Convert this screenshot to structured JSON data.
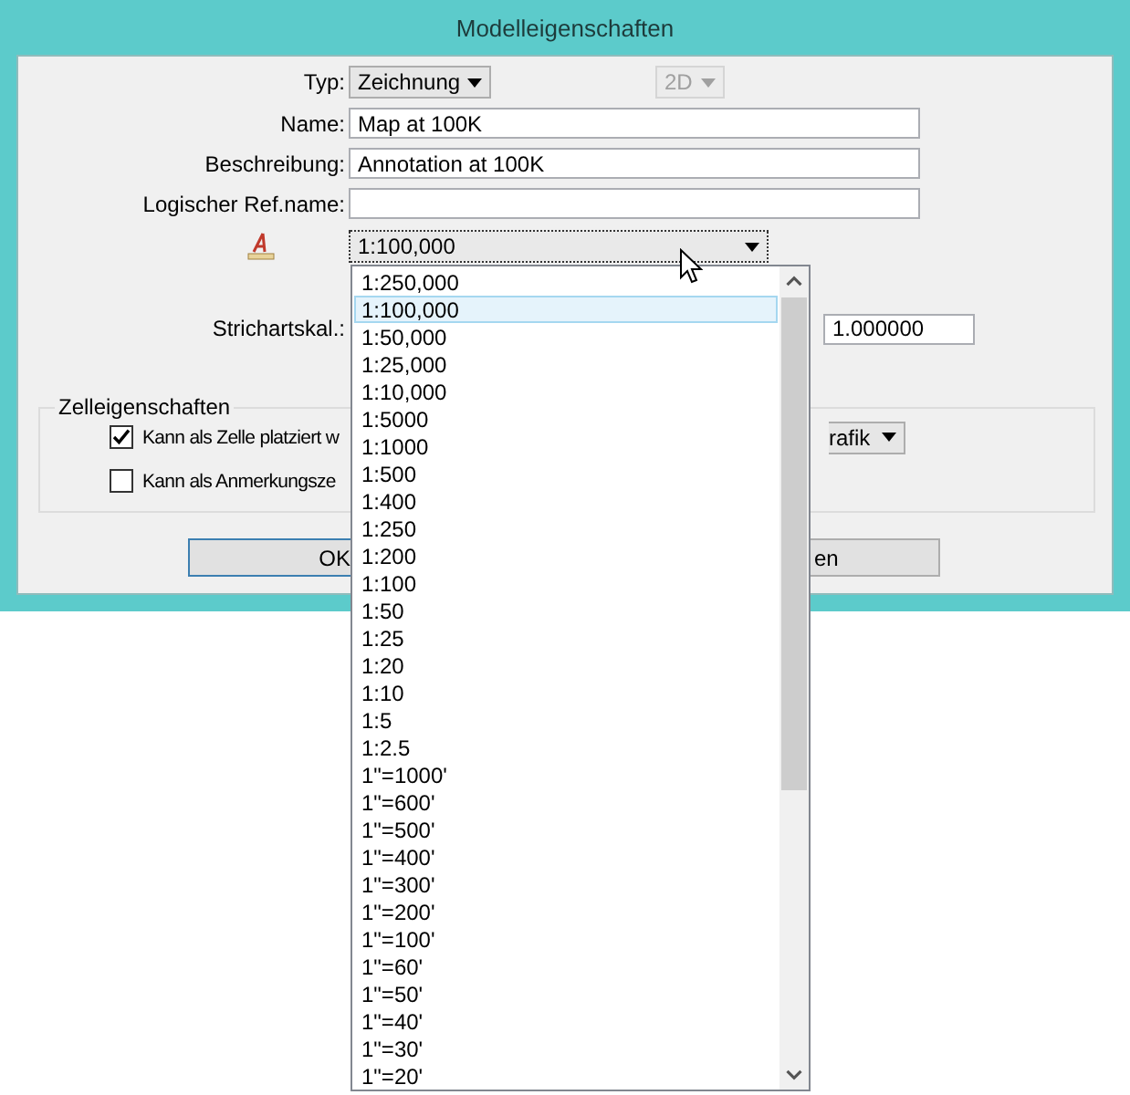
{
  "window": {
    "title": "Modelleigenschaften"
  },
  "type": {
    "label": "Typ:",
    "value": "Zeichnung"
  },
  "dimension": {
    "value": "2D",
    "disabled": true
  },
  "name": {
    "label": "Name:",
    "value": "Map at 100K"
  },
  "description": {
    "label": "Beschreibung:",
    "value": "Annotation at 100K"
  },
  "logical_ref": {
    "label": "Logischer Ref.name:"
  },
  "scale": {
    "value": "1:100,000"
  },
  "scale_list": [
    {
      "label": "1:250,000",
      "selected": false
    },
    {
      "label": "1:100,000",
      "selected": true
    },
    {
      "label": "1:50,000",
      "selected": false
    },
    {
      "label": "1:25,000",
      "selected": false
    },
    {
      "label": "1:10,000",
      "selected": false
    },
    {
      "label": "1:5000",
      "selected": false
    },
    {
      "label": "1:1000",
      "selected": false
    },
    {
      "label": "1:500",
      "selected": false
    },
    {
      "label": "1:400",
      "selected": false
    },
    {
      "label": "1:250",
      "selected": false
    },
    {
      "label": "1:200",
      "selected": false
    },
    {
      "label": "1:100",
      "selected": false
    },
    {
      "label": "1:50",
      "selected": false
    },
    {
      "label": "1:25",
      "selected": false
    },
    {
      "label": "1:20",
      "selected": false
    },
    {
      "label": "1:10",
      "selected": false
    },
    {
      "label": "1:5",
      "selected": false
    },
    {
      "label": "1:2.5",
      "selected": false
    },
    {
      "label": "1\"=1000'",
      "selected": false
    },
    {
      "label": "1\"=600'",
      "selected": false
    },
    {
      "label": "1\"=500'",
      "selected": false
    },
    {
      "label": "1\"=400'",
      "selected": false
    },
    {
      "label": "1\"=300'",
      "selected": false
    },
    {
      "label": "1\"=200'",
      "selected": false
    },
    {
      "label": "1\"=100'",
      "selected": false
    },
    {
      "label": "1\"=60'",
      "selected": false
    },
    {
      "label": "1\"=50'",
      "selected": false
    },
    {
      "label": "1\"=40'",
      "selected": false
    },
    {
      "label": "1\"=30'",
      "selected": false
    },
    {
      "label": "1\"=20'",
      "selected": false
    }
  ],
  "line_style_scale": {
    "label": "Strichartskal.:",
    "value": "1.000000"
  },
  "cell_properties": {
    "title": "Zelleigenschaften",
    "options": [
      {
        "label": "Kann als Zelle platziert w",
        "checked": true,
        "dropdown": "rafik"
      },
      {
        "label": "Kann als Anmerkungsze",
        "checked": false
      }
    ]
  },
  "buttons": [
    "OK",
    "en"
  ]
}
